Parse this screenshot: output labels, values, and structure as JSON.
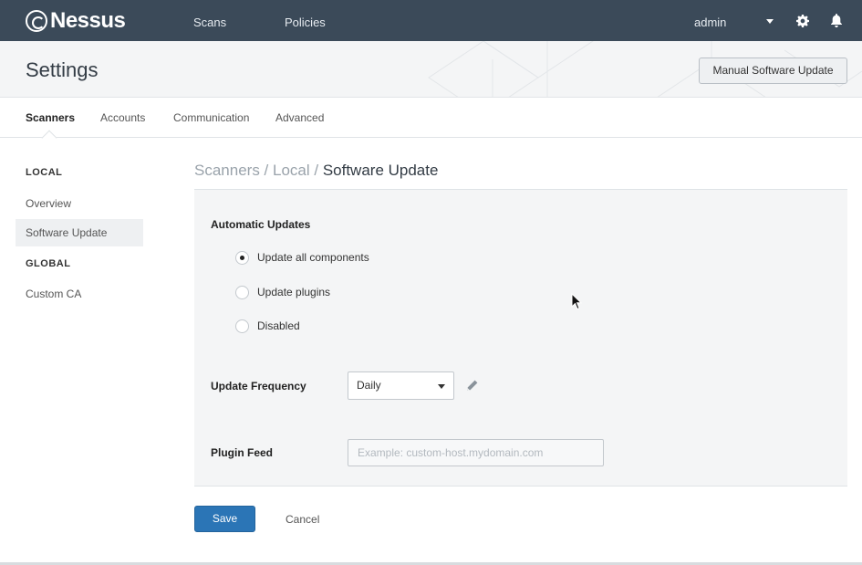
{
  "app": {
    "brand": "Nessus",
    "nav": {
      "scans": "Scans",
      "policies": "Policies"
    },
    "user": "admin",
    "icons": [
      "nessus-logo-icon",
      "caret-down-icon",
      "gear-icon",
      "bell-icon"
    ]
  },
  "header": {
    "title": "Settings",
    "manual_update_label": "Manual Software Update"
  },
  "tabs": [
    {
      "label": "Scanners",
      "active": true
    },
    {
      "label": "Accounts",
      "active": false
    },
    {
      "label": "Communication",
      "active": false
    },
    {
      "label": "Advanced",
      "active": false
    }
  ],
  "sidebar": {
    "local_heading": "LOCAL",
    "items_local": [
      {
        "label": "Overview",
        "active": false
      },
      {
        "label": "Software Update",
        "active": true
      }
    ],
    "global_heading": "GLOBAL",
    "items_global": [
      {
        "label": "Custom CA",
        "active": false
      }
    ]
  },
  "breadcrumb": {
    "part1": "Scanners",
    "sep": " / ",
    "part2": "Local",
    "current": "Software Update"
  },
  "form": {
    "automatic_updates_label": "Automatic Updates",
    "options": [
      {
        "label": "Update all components",
        "checked": true
      },
      {
        "label": "Update plugins",
        "checked": false
      },
      {
        "label": "Disabled",
        "checked": false
      }
    ],
    "frequency_label": "Update Frequency",
    "frequency_value": "Daily",
    "plugin_feed_label": "Plugin Feed",
    "plugin_feed_value": "",
    "plugin_feed_placeholder": "Example: custom-host.mydomain.com"
  },
  "actions": {
    "save_label": "Save",
    "cancel_label": "Cancel"
  },
  "colors": {
    "navbar": "#3b4a59",
    "primary_button": "#2b75b6",
    "panel_bg": "#f4f5f6"
  }
}
